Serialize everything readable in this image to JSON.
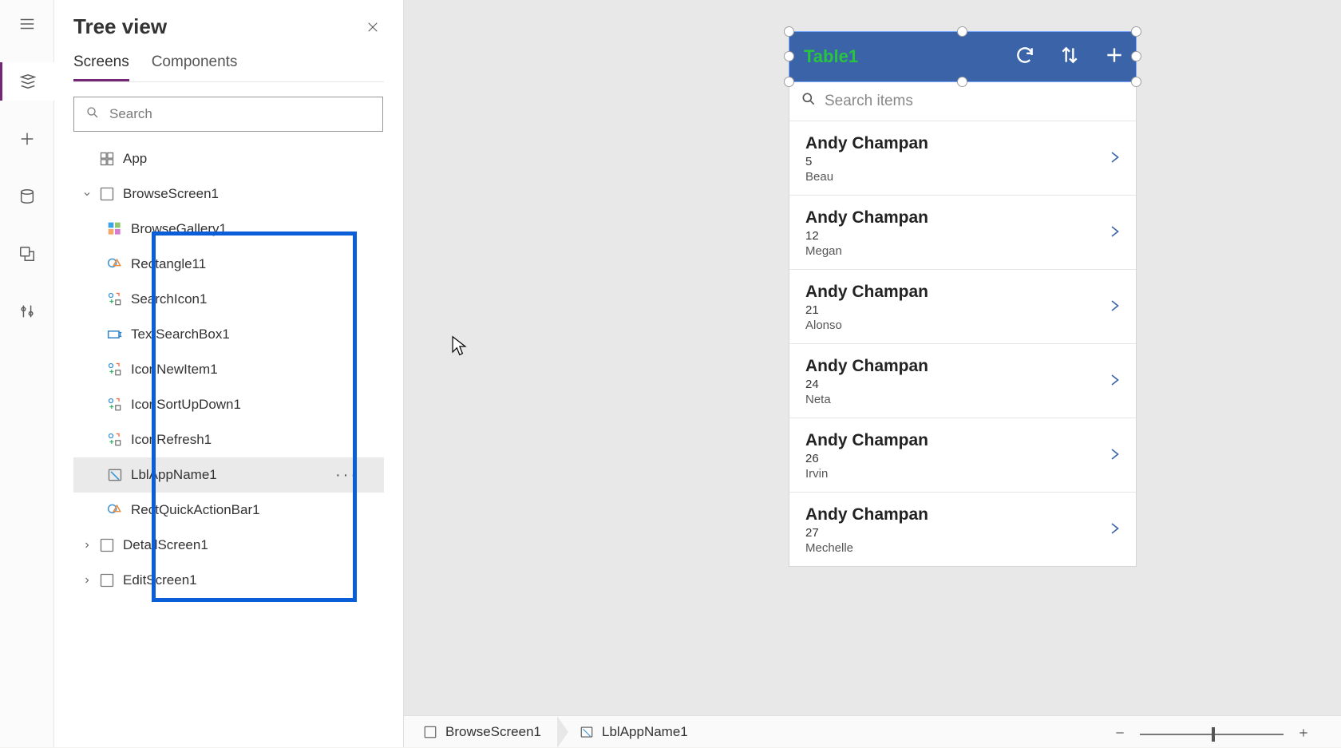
{
  "panel": {
    "title": "Tree view",
    "tabs": [
      "Screens",
      "Components"
    ],
    "active_tab": 0,
    "search_placeholder": "Search",
    "app_row": "App",
    "screens": [
      {
        "name": "BrowseScreen1",
        "expanded": true,
        "children": [
          {
            "name": "BrowseGallery1",
            "icon": "gallery"
          },
          {
            "name": "Rectangle11",
            "icon": "shape"
          },
          {
            "name": "SearchIcon1",
            "icon": "group"
          },
          {
            "name": "TextSearchBox1",
            "icon": "textbox"
          },
          {
            "name": "IconNewItem1",
            "icon": "group"
          },
          {
            "name": "IconSortUpDown1",
            "icon": "group"
          },
          {
            "name": "IconRefresh1",
            "icon": "group"
          },
          {
            "name": "LblAppName1",
            "icon": "label",
            "selected": true
          },
          {
            "name": "RectQuickActionBar1",
            "icon": "shape"
          }
        ]
      },
      {
        "name": "DetailScreen1",
        "expanded": false
      },
      {
        "name": "EditScreen1",
        "expanded": false
      }
    ]
  },
  "phone": {
    "title": "Table1",
    "search_placeholder": "Search items",
    "items": [
      {
        "title": "Andy Champan",
        "line1": "5",
        "line2": "Beau"
      },
      {
        "title": "Andy Champan",
        "line1": "12",
        "line2": "Megan"
      },
      {
        "title": "Andy Champan",
        "line1": "21",
        "line2": "Alonso"
      },
      {
        "title": "Andy Champan",
        "line1": "24",
        "line2": "Neta"
      },
      {
        "title": "Andy Champan",
        "line1": "26",
        "line2": "Irvin"
      },
      {
        "title": "Andy Champan",
        "line1": "27",
        "line2": "Mechelle"
      }
    ]
  },
  "breadcrumb": [
    "BrowseScreen1",
    "LblAppName1"
  ]
}
